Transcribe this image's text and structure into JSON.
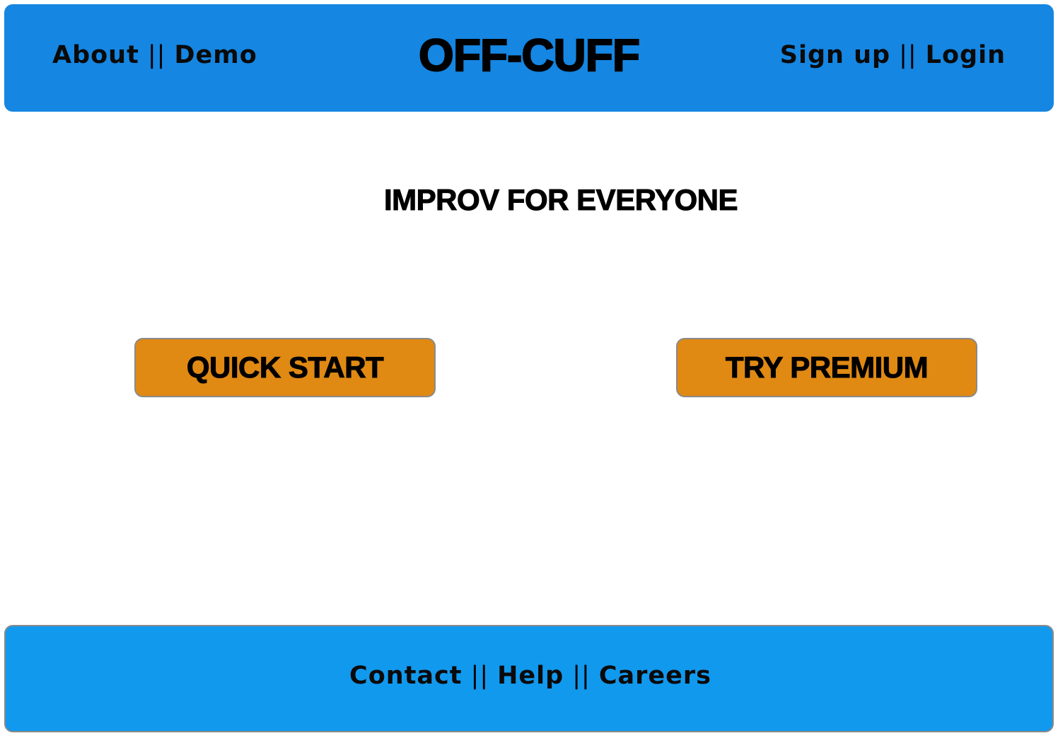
{
  "header": {
    "brand": "OFF-CUFF",
    "nav_left": [
      "About",
      "Demo"
    ],
    "nav_right": [
      "Sign up",
      "Login"
    ],
    "separator": "||",
    "background_color": "#1586e2"
  },
  "main": {
    "tagline": "IMPROV FOR EVERYONE",
    "buttons": {
      "quick_start": "QUICK START",
      "try_premium": "TRY PREMIUM"
    },
    "button_color": "#e08913"
  },
  "footer": {
    "links": [
      "Contact",
      "Help",
      "Careers"
    ],
    "separator": "||",
    "background_color": "#1199ee"
  }
}
